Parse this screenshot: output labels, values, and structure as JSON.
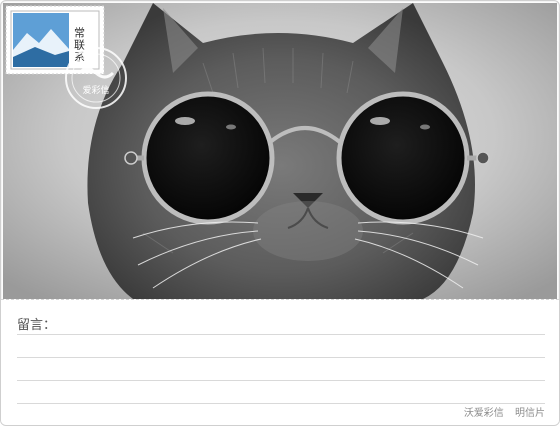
{
  "stamp": {
    "text": "常联系"
  },
  "postmark": {
    "text": "爱彩信"
  },
  "message": {
    "label": "留言："
  },
  "footer": {
    "brand": "沃爱彩信",
    "type": "明信片"
  },
  "colors": {
    "border": "#cfcfcf",
    "rule": "#d9d9d9",
    "muted": "#8c8c8c"
  }
}
